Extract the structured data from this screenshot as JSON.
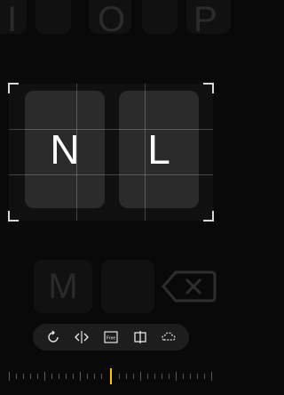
{
  "background_keyboard": {
    "top_row_letters": [
      "I",
      "O",
      "P"
    ],
    "bottom_row_letters": [
      "M"
    ]
  },
  "crop_preview": {
    "keys": [
      "N",
      "L"
    ]
  },
  "toolbar": {
    "tools": [
      "rotate-icon",
      "flip-horizontal-icon",
      "free-aspect-icon",
      "mirror-icon",
      "lasso-icon"
    ],
    "free_label": "Free"
  },
  "colors": {
    "accent": "#ffc400",
    "background": "#090909",
    "toolbar_bg": "#1d1d1d"
  }
}
